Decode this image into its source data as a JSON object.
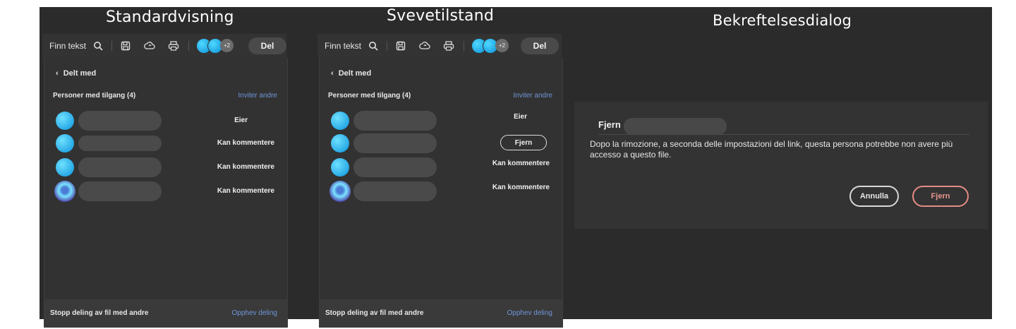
{
  "captions": {
    "default": "Standardvisning",
    "hover": "Svevetilstand",
    "confirm": "Bekreftelsesdialog"
  },
  "toolbar": {
    "find_text": "Finn tekst",
    "avatar_more": "+2",
    "share_label": "Del"
  },
  "panel": {
    "back_label": "Delt med",
    "section_label": "Personer med tilgang (4)",
    "invite_label": "Inviter andre",
    "rows": [
      {
        "role": "Eier"
      },
      {
        "role": "Kan kommentere"
      },
      {
        "role": "Kan kommentere"
      },
      {
        "role": "Kan kommentere"
      }
    ],
    "hover_remove_label": "Fjern",
    "stop_sharing_label": "Stopp deling av fil med andre",
    "unshare_label": "Opphev deling"
  },
  "dialog": {
    "title": "Fjern",
    "message": "Dopo la rimozione, a seconda delle impostazioni del link, questa persona potrebbe non avere più accesso a questo file.",
    "cancel_label": "Annulla",
    "remove_label": "Fjern"
  },
  "colors": {
    "background": "#2b2b2b",
    "link": "#6f97d9",
    "avatar": "#0a92db",
    "destructive": "#e58b84"
  }
}
